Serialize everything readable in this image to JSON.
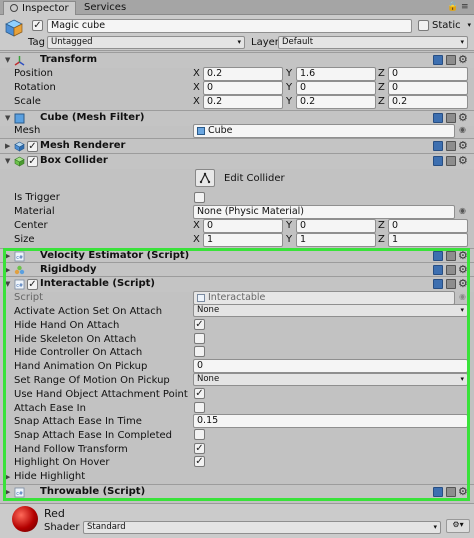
{
  "tabs": [
    {
      "label": "Inspector",
      "active": true
    },
    {
      "label": "Services",
      "active": false
    }
  ],
  "object": {
    "active": true,
    "name": "Magic cube",
    "static_label": "Static",
    "static_checked": false,
    "tag_label": "Tag",
    "tag_value": "Untagged",
    "layer_label": "Layer",
    "layer_value": "Default"
  },
  "transform": {
    "title": "Transform",
    "rows": [
      {
        "label": "Position",
        "x": "0.2",
        "y": "1.6",
        "z": "0"
      },
      {
        "label": "Rotation",
        "x": "0",
        "y": "0",
        "z": "0"
      },
      {
        "label": "Scale",
        "x": "0.2",
        "y": "0.2",
        "z": "0.2"
      }
    ]
  },
  "axis_labels": {
    "x": "X",
    "y": "Y",
    "z": "Z"
  },
  "mesh_filter": {
    "title": "Cube (Mesh Filter)",
    "field_label": "Mesh",
    "value": "Cube"
  },
  "mesh_renderer": {
    "title": "Mesh Renderer",
    "enabled": true
  },
  "box_collider": {
    "title": "Box Collider",
    "enabled": true,
    "edit_label": "Edit Collider",
    "is_trigger_label": "Is Trigger",
    "is_trigger": false,
    "material_label": "Material",
    "material_value": "None (Physic Material)",
    "center_label": "Center",
    "center": {
      "x": "0",
      "y": "0",
      "z": "0"
    },
    "size_label": "Size",
    "size": {
      "x": "1",
      "y": "1",
      "z": "1"
    }
  },
  "velocity_estimator": {
    "title": "Velocity Estimator (Script)"
  },
  "rigidbody": {
    "title": "Rigidbody"
  },
  "interactable": {
    "title": "Interactable (Script)",
    "enabled": true,
    "script_label": "Script",
    "script_value": "Interactable",
    "fields": [
      {
        "label": "Activate Action Set On Attach",
        "type": "dropdown",
        "value": "None"
      },
      {
        "label": "Hide Hand On Attach",
        "type": "checkbox",
        "checked": true
      },
      {
        "label": "Hide Skeleton On Attach",
        "type": "checkbox",
        "checked": false
      },
      {
        "label": "Hide Controller On Attach",
        "type": "checkbox",
        "checked": false
      },
      {
        "label": "Hand Animation On Pickup",
        "type": "text",
        "value": "0"
      },
      {
        "label": "Set Range Of Motion On Pickup",
        "type": "dropdown",
        "value": "None"
      },
      {
        "label": "Use Hand Object Attachment Point",
        "type": "checkbox",
        "checked": true
      },
      {
        "label": "Attach Ease In",
        "type": "checkbox",
        "checked": false
      },
      {
        "label": "Snap Attach Ease In Time",
        "type": "text",
        "value": "0.15"
      },
      {
        "label": "Snap Attach Ease In Completed",
        "type": "checkbox",
        "checked": false
      },
      {
        "label": "Hand Follow Transform",
        "type": "checkbox",
        "checked": true
      },
      {
        "label": "Highlight On Hover",
        "type": "checkbox",
        "checked": true
      }
    ],
    "hide_highlight_label": "Hide Highlight"
  },
  "throwable": {
    "title": "Throwable (Script)"
  },
  "material": {
    "name": "Red",
    "shader_label": "Shader",
    "shader_value": "Standard"
  },
  "colors": {
    "highlight": "#39e23a",
    "sphere": "#c00000"
  }
}
